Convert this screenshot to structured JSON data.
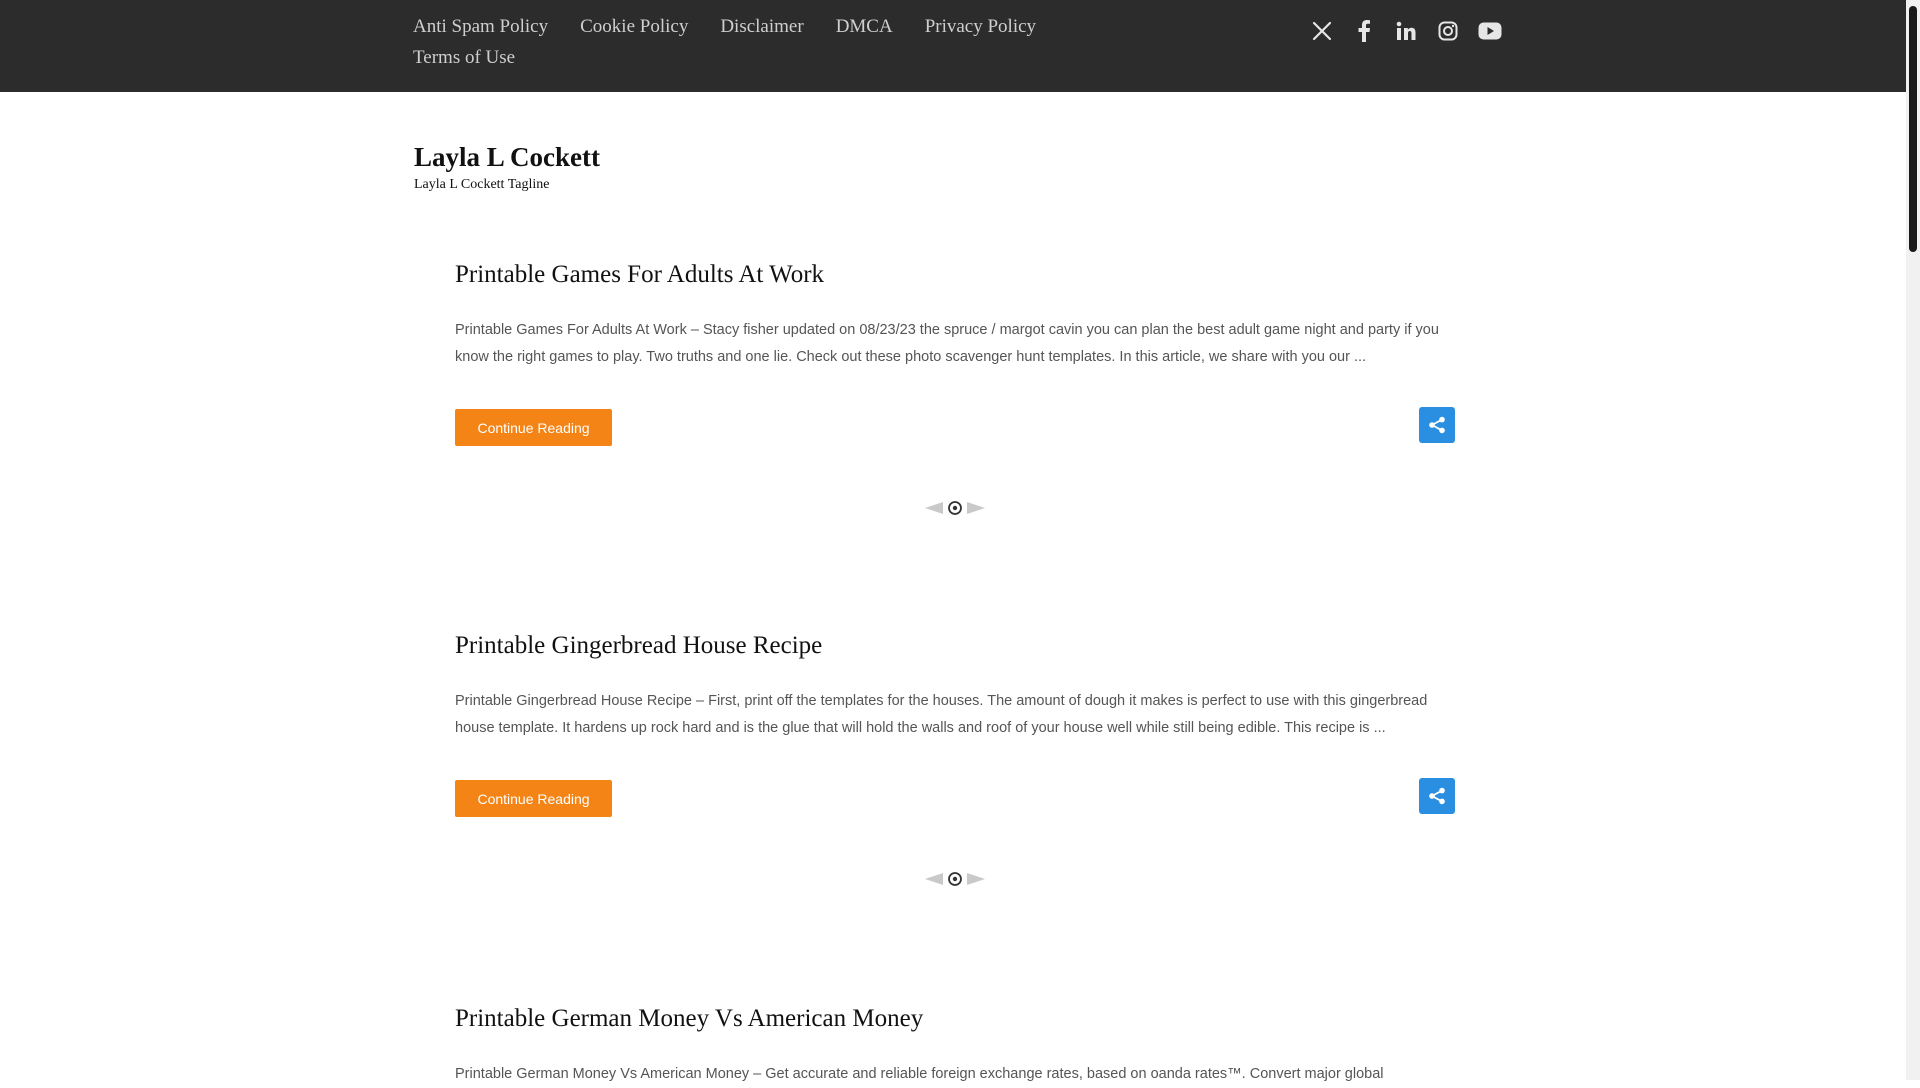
{
  "topnav": {
    "items": [
      {
        "label": "Anti Spam Policy"
      },
      {
        "label": "Cookie Policy"
      },
      {
        "label": "Disclaimer"
      },
      {
        "label": "DMCA"
      },
      {
        "label": "Privacy Policy"
      },
      {
        "label": "Terms of Use"
      }
    ]
  },
  "social": [
    "x-icon",
    "facebook-icon",
    "linkedin-icon",
    "instagram-icon",
    "youtube-icon"
  ],
  "site": {
    "title": "Layla L Cockett",
    "tagline": "Layla L Cockett Tagline"
  },
  "posts": [
    {
      "title": "Printable Games For Adults At Work",
      "excerpt": "Printable Games For Adults At Work – Stacy fisher updated on 08/23/23 the spruce / margot cavin you can plan the best adult game night and party if you know the right games to play. Two truths and one lie. Check out these photo scavenger hunt templates. In this article, we share with you our ...",
      "button": "Continue Reading"
    },
    {
      "title": "Printable Gingerbread House Recipe",
      "excerpt": "Printable Gingerbread House Recipe – First, print off the templates for the houses. The amount of dough it makes is perfect to use with this gingerbread house template. It hardens up rock hard and is the glue that will hold the walls and roof of your house well while still being edible. This recipe is ...",
      "button": "Continue Reading"
    },
    {
      "title": "Printable German Money Vs American Money",
      "excerpt": "Printable German Money Vs American Money – Get accurate and reliable foreign exchange rates, based on oanda rates™. Convert major global"
    }
  ],
  "colors": {
    "topbar": "#2c2c2c",
    "button": "#f48416",
    "share": "#2a8fe1"
  }
}
